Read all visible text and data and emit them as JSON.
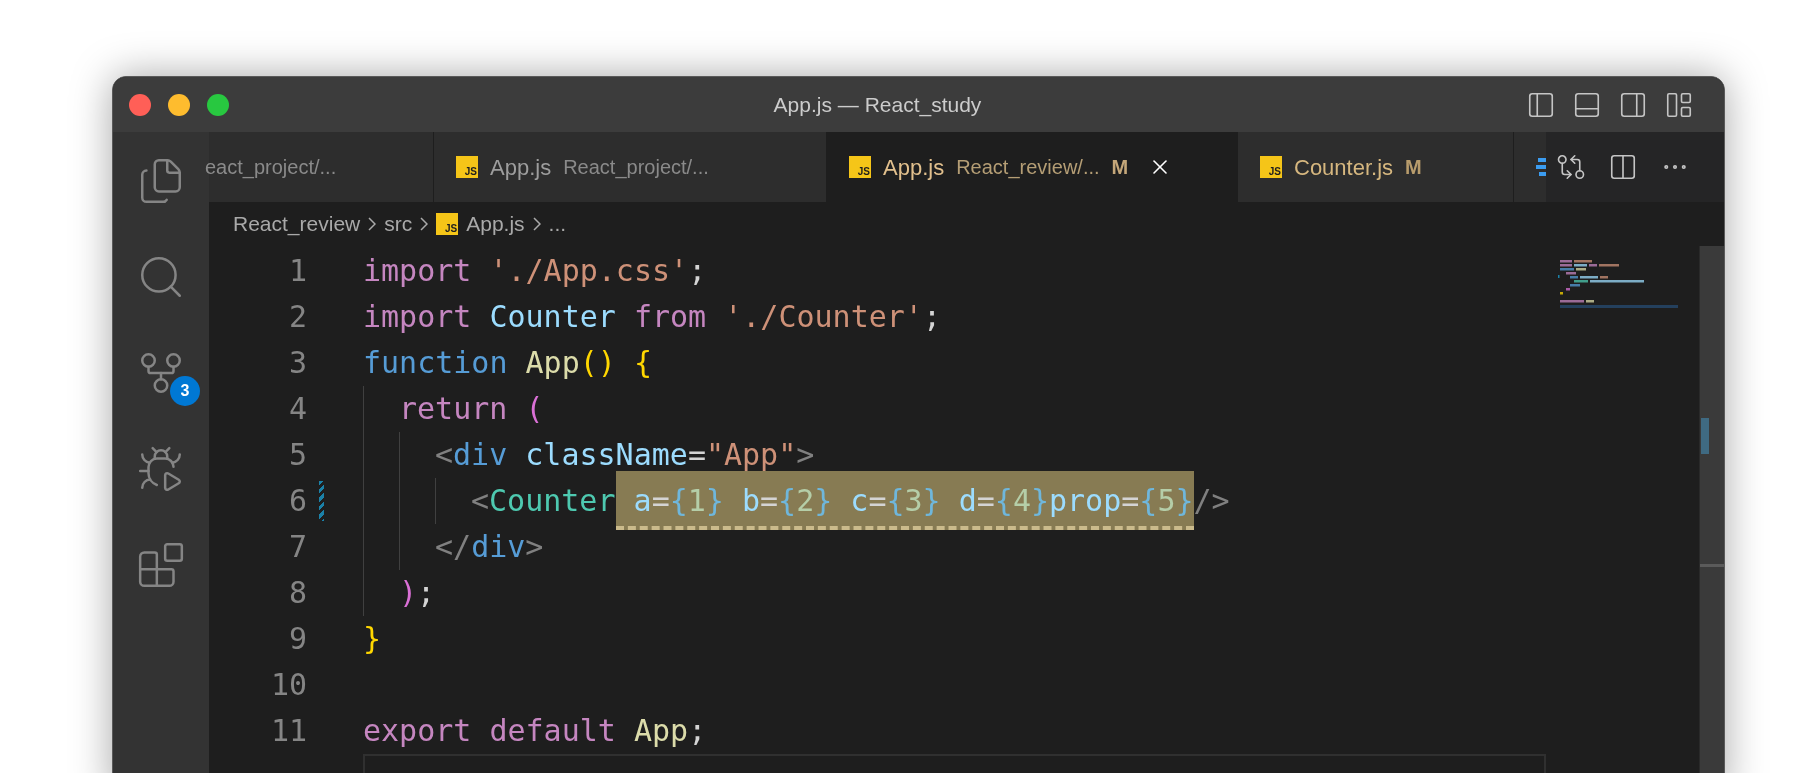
{
  "window": {
    "title": "App.js — React_study"
  },
  "activity_bar": [
    {
      "kind": "files"
    },
    {
      "kind": "search"
    },
    {
      "kind": "source-control",
      "badge": "3"
    },
    {
      "kind": "debug"
    },
    {
      "kind": "extensions"
    }
  ],
  "tabs": [
    {
      "label": "eact_project/...",
      "selected": false,
      "modified": false,
      "clipped": true
    },
    {
      "icon": "JS",
      "label": "App.js",
      "path": "React_project/...",
      "selected": false,
      "modified": false,
      "clipped": false
    },
    {
      "icon": "JS",
      "label": "App.js",
      "path": "React_review/...",
      "selected": true,
      "modified": true,
      "badge": "M",
      "clipped": false
    },
    {
      "icon": "JS",
      "label": "Counter.js",
      "selected": false,
      "modified": true,
      "badge": "M",
      "clipped": false
    }
  ],
  "breadcrumb": [
    {
      "label": "React_review"
    },
    {
      "label": "src"
    },
    {
      "icon": "JS",
      "label": "App.js"
    },
    {
      "label": "..."
    }
  ],
  "lines": [
    {
      "number": "1",
      "modified": false,
      "current": false,
      "tokens": [
        {
          "kind": "keyword",
          "text": "import "
        },
        {
          "kind": "string",
          "text": "'./App.css'"
        },
        {
          "kind": "punct",
          "text": ";"
        }
      ]
    },
    {
      "number": "2",
      "modified": false,
      "current": false,
      "tokens": [
        {
          "kind": "keyword",
          "text": "import "
        },
        {
          "kind": "variable",
          "text": "Counter "
        },
        {
          "kind": "keyword",
          "text": "from "
        },
        {
          "kind": "string",
          "text": "'./Counter'"
        },
        {
          "kind": "punct",
          "text": ";"
        }
      ]
    },
    {
      "number": "3",
      "modified": false,
      "current": false,
      "tokens": [
        {
          "kind": "storage",
          "text": "function "
        },
        {
          "kind": "function",
          "text": "App"
        },
        {
          "kind": "bracket1",
          "text": "() {"
        }
      ]
    },
    {
      "number": "4",
      "modified": false,
      "current": false,
      "indent": [
        {
          "kind": "guide"
        }
      ],
      "tokens": [
        {
          "kind": "keyword",
          "text": "return "
        },
        {
          "kind": "bracket2",
          "text": "("
        }
      ]
    },
    {
      "number": "5",
      "modified": false,
      "current": false,
      "indent": [
        {
          "kind": "guide"
        },
        {
          "kind": "guide"
        }
      ],
      "tokens": [
        {
          "kind": "tagpunct",
          "text": "<"
        },
        {
          "kind": "tag",
          "text": "div "
        },
        {
          "kind": "attr",
          "text": "className"
        },
        {
          "kind": "punct",
          "text": "="
        },
        {
          "kind": "string",
          "text": "\"App\""
        },
        {
          "kind": "tagpunct",
          "text": ">"
        }
      ]
    },
    {
      "number": "6",
      "modified": true,
      "current": false,
      "indent": [
        {
          "kind": "guide"
        },
        {
          "kind": "guide"
        },
        {
          "kind": "guide"
        }
      ],
      "tokens": [
        {
          "kind": "tagpunct",
          "text": "<"
        },
        {
          "kind": "component",
          "text": "Counter"
        },
        {
          "kind": "highlight",
          "children": [
            {
              "kind": "attr",
              "text": " a"
            },
            {
              "kind": "punct",
              "text": "="
            },
            {
              "kind": "brace",
              "text": "{"
            },
            {
              "kind": "number",
              "text": "1"
            },
            {
              "kind": "brace",
              "text": "} "
            },
            {
              "kind": "attr",
              "text": "b"
            },
            {
              "kind": "punct",
              "text": "="
            },
            {
              "kind": "brace",
              "text": "{"
            },
            {
              "kind": "number",
              "text": "2"
            },
            {
              "kind": "brace",
              "text": "} "
            },
            {
              "kind": "attr",
              "text": "c"
            },
            {
              "kind": "punct",
              "text": "="
            },
            {
              "kind": "brace",
              "text": "{"
            },
            {
              "kind": "number",
              "text": "3"
            },
            {
              "kind": "brace",
              "text": "} "
            },
            {
              "kind": "attr",
              "text": "d"
            },
            {
              "kind": "punct",
              "text": "="
            },
            {
              "kind": "brace",
              "text": "{"
            },
            {
              "kind": "number",
              "text": "4"
            },
            {
              "kind": "brace",
              "text": "}"
            },
            {
              "kind": "attr",
              "text": "prop"
            },
            {
              "kind": "punct",
              "text": "="
            },
            {
              "kind": "brace",
              "text": "{"
            },
            {
              "kind": "number",
              "text": "5"
            },
            {
              "kind": "brace",
              "text": "}"
            }
          ]
        },
        {
          "kind": "tagpunct",
          "text": "/>"
        }
      ]
    },
    {
      "number": "7",
      "modified": false,
      "current": false,
      "indent": [
        {
          "kind": "guide"
        },
        {
          "kind": "guide"
        }
      ],
      "tokens": [
        {
          "kind": "tagpunct",
          "text": "</"
        },
        {
          "kind": "tag",
          "text": "div"
        },
        {
          "kind": "tagpunct",
          "text": ">"
        }
      ]
    },
    {
      "number": "8",
      "modified": false,
      "current": false,
      "indent": [
        {
          "kind": "guide"
        }
      ],
      "tokens": [
        {
          "kind": "bracket2",
          "text": ")"
        },
        {
          "kind": "punct",
          "text": ";"
        }
      ]
    },
    {
      "number": "9",
      "modified": false,
      "current": false,
      "tokens": [
        {
          "kind": "bracket1",
          "text": "}"
        }
      ]
    },
    {
      "number": "10",
      "modified": false,
      "current": false
    },
    {
      "number": "11",
      "modified": false,
      "current": false,
      "tokens": [
        {
          "kind": "keyword",
          "text": "export "
        },
        {
          "kind": "keyword",
          "text": "default "
        },
        {
          "kind": "function",
          "text": "App"
        },
        {
          "kind": "punct",
          "text": ";"
        }
      ]
    },
    {
      "modified": false,
      "current": true
    }
  ]
}
